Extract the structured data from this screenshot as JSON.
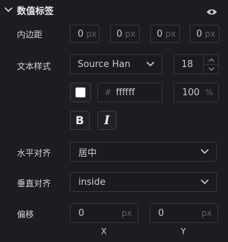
{
  "section": {
    "title": "数值标签"
  },
  "padding": {
    "label": "内边距",
    "unit": "px",
    "values": [
      "0",
      "0",
      "0",
      "0"
    ]
  },
  "text_style": {
    "label": "文本样式",
    "font_family": "Source Han",
    "font_size": "18",
    "color_hex_prefix": "#",
    "color_hex": "ffffff",
    "opacity_value": "100",
    "opacity_unit": "%",
    "color": "#ffffff",
    "bold_label": "B",
    "italic_label": "I"
  },
  "horizontal_align": {
    "label": "水平对齐",
    "value": "居中"
  },
  "vertical_align": {
    "label": "垂直对齐",
    "value": "inside"
  },
  "offset": {
    "label": "偏移",
    "unit": "px",
    "x_value": "0",
    "y_value": "0",
    "x_caption": "X",
    "y_caption": "Y"
  }
}
